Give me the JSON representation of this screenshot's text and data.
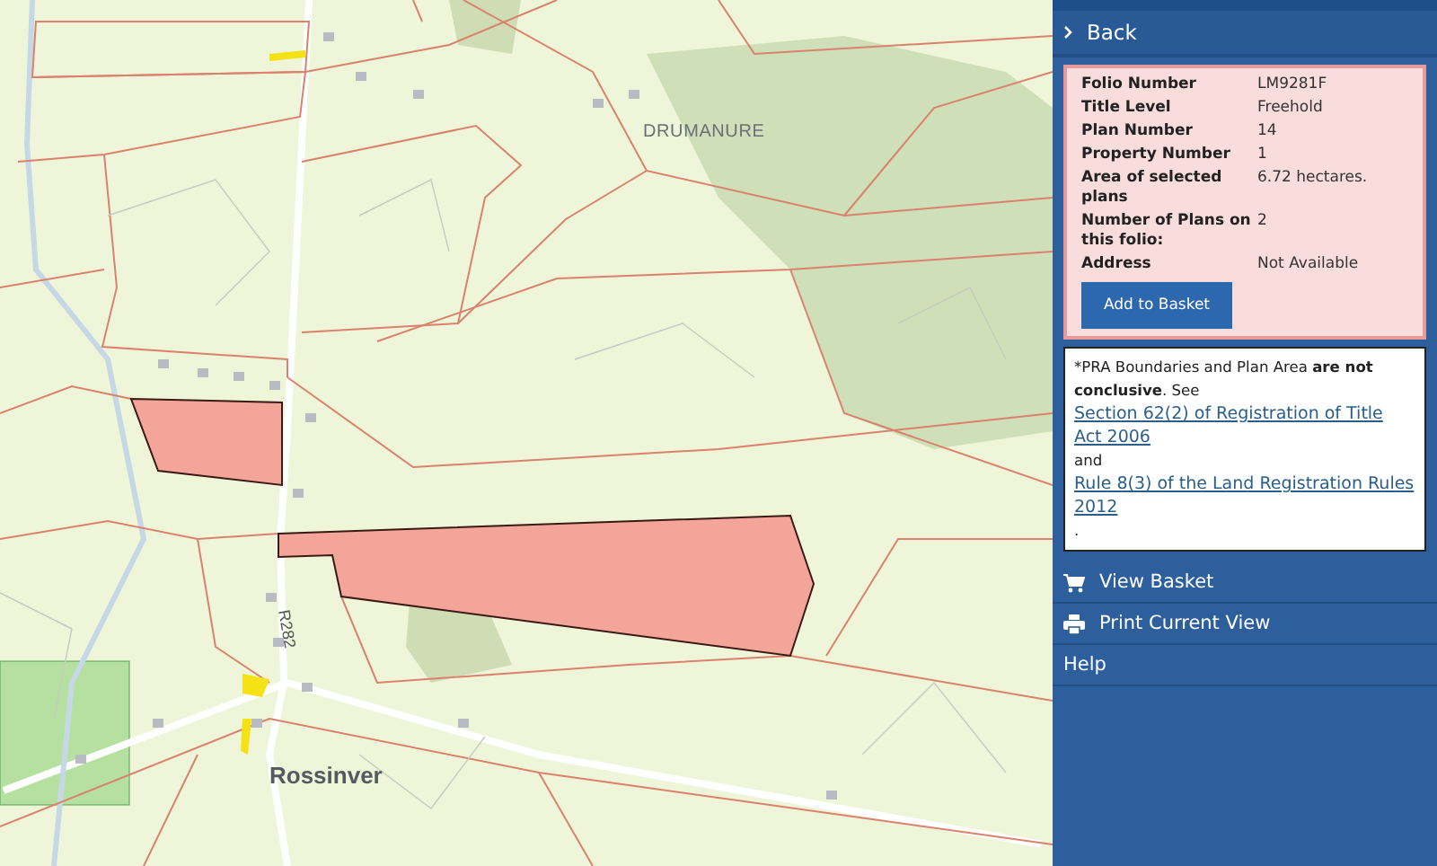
{
  "map": {
    "labels": [
      {
        "text": "DRUMANURE",
        "kind": "townland"
      },
      {
        "text": "R282",
        "kind": "road"
      },
      {
        "text": "Rossinver",
        "kind": "village"
      }
    ],
    "plots": [
      {
        "selected": true
      },
      {
        "selected": true
      }
    ]
  },
  "panel": {
    "back": "Back",
    "details": [
      {
        "label": "Folio Number",
        "value": "LM9281F"
      },
      {
        "label": "Title Level",
        "value": "Freehold"
      },
      {
        "label": "Plan Number",
        "value": "14"
      },
      {
        "label": "Property Number",
        "value": "1"
      },
      {
        "label": "Area of selected plans",
        "value": "6.72 hectares."
      },
      {
        "label": "Number of Plans on this folio:",
        "value": "2"
      },
      {
        "label": "Address",
        "value": "Not Available"
      }
    ],
    "add_button": "Add to Basket",
    "notice": [
      {
        "kind": "text",
        "text": "*PRA Boundaries and Plan Area **are not conclusive**. See "
      },
      {
        "kind": "link",
        "text": "Section 62(2) of Registration of Title Act 2006"
      },
      {
        "kind": "text",
        "text": " and "
      },
      {
        "kind": "link",
        "text": "Rule 8(3) of the Land Registration Rules 2012"
      },
      {
        "kind": "text",
        "text": "."
      }
    ],
    "menu": [
      {
        "label": "View Basket",
        "kind": "basket"
      },
      {
        "label": "Print Current View",
        "kind": "print"
      },
      {
        "label": "Help",
        "kind": "plain"
      }
    ]
  }
}
